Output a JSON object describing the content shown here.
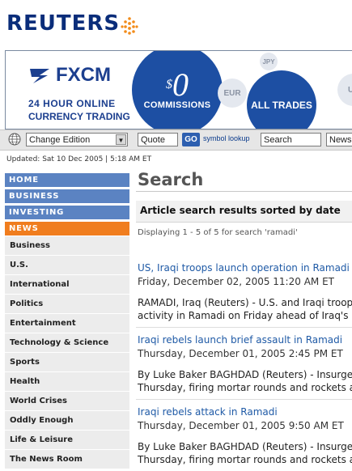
{
  "header": {
    "logo": "REUTERS"
  },
  "ad": {
    "brand": "FXCM",
    "tagline1": "24 HOUR ONLINE",
    "tagline2": "CURRENCY TRADING",
    "zero": "0",
    "dollar": "$",
    "commissions": "COMMISSIONS",
    "all_trades": "ALL TRADES",
    "eur": "EUR",
    "jpy": "JPY",
    "usd": "US"
  },
  "toolbar": {
    "edition_select": "Change Edition",
    "quote_input": "Quote",
    "go_label": "GO",
    "symbol_lookup": "symbol lookup",
    "search_input": "Search",
    "scope_select": "News"
  },
  "updated": "Updated: Sat 10 Dec 2005 | 5:18 AM ET",
  "nav": {
    "top": [
      {
        "label": "HOME",
        "style": "blue"
      },
      {
        "label": "BUSINESS",
        "style": "blue"
      },
      {
        "label": "INVESTING",
        "style": "blue"
      },
      {
        "label": "NEWS",
        "style": "orange"
      }
    ],
    "items": [
      "Business",
      "U.S.",
      "International",
      "Politics",
      "Entertainment",
      "Technology & Science",
      "Sports",
      "Health",
      "World Crises",
      "Oddly Enough",
      "Life & Leisure",
      "The News Room"
    ]
  },
  "main": {
    "title": "Search",
    "results_heading": "Article search results sorted by date",
    "displaying": "Displaying 1 - 5 of 5 for search 'ramadi'",
    "articles": [
      {
        "title": "US, Iraqi troops launch operation in Ramadi",
        "date": "Friday, December 02, 2005 11:20 AM ET",
        "body1": "RAMADI, Iraq (Reuters) - U.S. and Iraqi troops",
        "body2": "activity in Ramadi on Friday ahead of Iraq's De"
      },
      {
        "title": "Iraqi rebels launch brief assault in Ramadi",
        "date": "Thursday, December 01, 2005 2:45 PM ET",
        "body1": "By Luke Baker BAGHDAD (Reuters) - Insurge",
        "body2": "Thursday, firing mortar rounds and rockets at a"
      },
      {
        "title": "Iraqi rebels attack in Ramadi",
        "date": "Thursday, December 01, 2005 9:50 AM ET",
        "body1": "By Luke Baker BAGHDAD (Reuters) - Insurge",
        "body2": "Thursday, firing mortar rounds and rockets at a"
      }
    ]
  },
  "colors": {
    "brand": "#0a2d7a",
    "nav_blue": "#5b83c2",
    "nav_orange": "#f07d1e",
    "link": "#1f5aa6"
  }
}
